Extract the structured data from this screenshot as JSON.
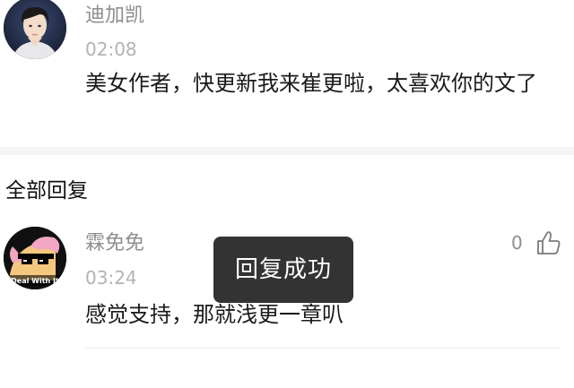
{
  "comment": {
    "username": "迪加凯",
    "time": "02:08",
    "content": "美女作者，快更新我来崔更啦，太喜欢你的文了"
  },
  "replies_section": {
    "title": "全部回复"
  },
  "reply": {
    "username": "霖免免",
    "time": "03:24",
    "content": "感觉支持，那就浅更一章叭",
    "like_count": "0",
    "avatar_caption": "Deal With It"
  },
  "toast": {
    "message": "回复成功"
  },
  "icons": {
    "like": "thumbs-up-icon"
  },
  "colors": {
    "username": "#8e8e93",
    "time": "#b3b3b3",
    "text": "#1a1a1a",
    "toast_bg": "#222222"
  }
}
